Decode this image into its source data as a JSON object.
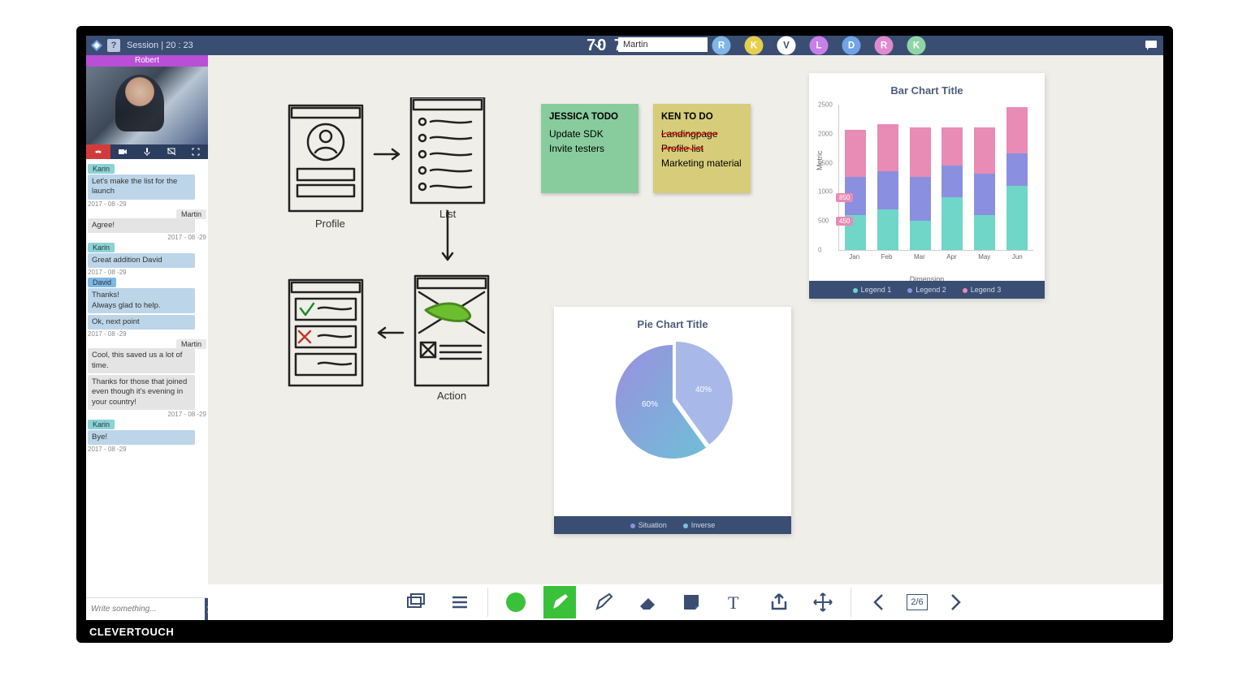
{
  "topbar": {
    "session_label": "Session | 20 : 23",
    "pin": "70 76 55",
    "name_value": "Martin",
    "help": "?",
    "avatars": [
      {
        "letter": "R",
        "color": "#7fb6e6"
      },
      {
        "letter": "K",
        "color": "#e6cf4d"
      },
      {
        "letter": "V",
        "color": "#ffffff"
      },
      {
        "letter": "L",
        "color": "#c97fe8"
      },
      {
        "letter": "D",
        "color": "#6fa4e6"
      },
      {
        "letter": "R",
        "color": "#e08bd0"
      },
      {
        "letter": "K",
        "color": "#8fd6a6"
      }
    ]
  },
  "video": {
    "label": "Robert"
  },
  "chat": [
    {
      "who": "Karin",
      "cls": "k",
      "text": "Let's make the list for the launch",
      "ts": "2017 - 08 -29"
    },
    {
      "who": "Martin",
      "cls": "m",
      "text": "Agree!",
      "ts": "2017 - 08 -29",
      "right": true
    },
    {
      "who": "Karin",
      "cls": "k",
      "text": "Great addition David",
      "ts": "2017 - 08 -29"
    },
    {
      "who": "David",
      "cls": "d",
      "text": "Thanks!\nAlways glad to help.",
      "ts": ""
    },
    {
      "who": "",
      "cls": "",
      "text": "Ok, next point",
      "ts": "2017 - 08 -29"
    },
    {
      "who": "Martin",
      "cls": "m",
      "text": "Cool, this saved us a lot of time.",
      "ts": "",
      "right": true
    },
    {
      "who": "",
      "cls": "",
      "text": "Thanks for those that joined even though it's evening in your country!",
      "ts": "2017 - 08 -29",
      "right": true
    },
    {
      "who": "Karin",
      "cls": "k",
      "text": "Bye!",
      "ts": "2017 - 08 -29"
    }
  ],
  "compose_placeholder": "Write something...",
  "notes": {
    "green": {
      "title": "JESSICA TODO",
      "lines": [
        "Update SDK",
        "Invite testers"
      ]
    },
    "yellow": {
      "title": "KEN TO DO",
      "lines": [
        "Landingpage",
        "Profile list",
        "Marketing material"
      ]
    }
  },
  "sketch_labels": {
    "profile": "Profile",
    "list": "List",
    "action": "Action"
  },
  "pie": {
    "title": "Pie Chart Title",
    "legend": [
      {
        "label": "Situation",
        "color": "#8b8fe0"
      },
      {
        "label": "Inverse",
        "color": "#7fbfe0"
      }
    ]
  },
  "bar": {
    "title": "Bar Chart Title",
    "ylabel": "Metric",
    "xlabel": "Dimension",
    "legend": [
      {
        "label": "Legend 1",
        "color": "#6fd6c8"
      },
      {
        "label": "Legend 2",
        "color": "#8b8fe0"
      },
      {
        "label": "Legend 3",
        "color": "#e88bb5"
      }
    ],
    "annotations": [
      "850",
      "450"
    ]
  },
  "toolbar": {
    "page": "2/6"
  },
  "brand": "CLEVERTOUCH",
  "chart_data": [
    {
      "type": "pie",
      "title": "Pie Chart Title",
      "series": [
        {
          "name": "Situation",
          "value": 60
        },
        {
          "name": "Inverse",
          "value": 40
        }
      ],
      "labels": [
        "60%",
        "40%"
      ]
    },
    {
      "type": "bar",
      "title": "Bar Chart Title",
      "xlabel": "Dimension",
      "ylabel": "Metric",
      "ylim": [
        0,
        2500
      ],
      "yticks": [
        0,
        500,
        1000,
        1500,
        2000,
        2500
      ],
      "categories": [
        "Jan",
        "Feb",
        "Mar",
        "Apr",
        "May",
        "Jun"
      ],
      "series": [
        {
          "name": "Legend 1",
          "color": "#6fd6c8",
          "values": [
            600,
            700,
            500,
            900,
            600,
            1100
          ]
        },
        {
          "name": "Legend 2",
          "color": "#8b8fe0",
          "values": [
            650,
            650,
            750,
            550,
            700,
            550
          ]
        },
        {
          "name": "Legend 3",
          "color": "#e88bb5",
          "values": [
            800,
            800,
            850,
            650,
            800,
            800
          ]
        }
      ],
      "annotations": [
        {
          "label": "850",
          "y": 850
        },
        {
          "label": "450",
          "y": 450
        }
      ]
    }
  ]
}
